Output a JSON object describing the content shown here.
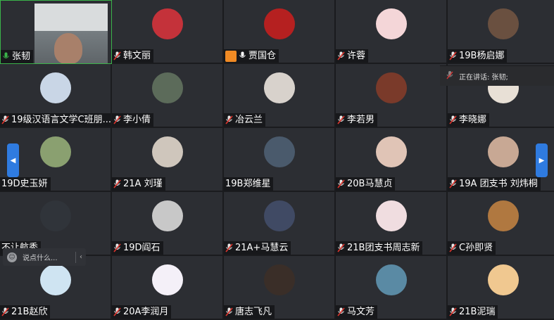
{
  "colors": {
    "speaking_border": "#3bb34a",
    "arrow_blue": "#2f7be0",
    "badge_orange": "#f08a24"
  },
  "participants": [
    {
      "name": "张韧",
      "mic": "active-mic-icon",
      "video": true,
      "avatar_bg": "#8a9296",
      "speaking": true
    },
    {
      "name": "韩文丽",
      "mic": "muted-mic-icon",
      "avatar_bg": "#c4323a"
    },
    {
      "name": "贾国仓",
      "mic": "mic-icon",
      "avatar_bg": "#b52020",
      "badge": "host-badge-icon"
    },
    {
      "name": "许蓉",
      "mic": "muted-mic-icon",
      "avatar_bg": "#f4d6d8"
    },
    {
      "name": "19B杨启娜",
      "mic": "muted-mic-icon",
      "avatar_bg": "#6a5040"
    },
    {
      "name": "19级汉语言文学C班朋...",
      "mic": "muted-mic-icon",
      "avatar_bg": "#c9d6e6"
    },
    {
      "name": "李小倩",
      "mic": "muted-mic-icon",
      "avatar_bg": "#5c6b5a"
    },
    {
      "name": "冶云兰",
      "mic": "muted-mic-icon",
      "avatar_bg": "#d8d2cc"
    },
    {
      "name": "李若男",
      "mic": "muted-mic-icon",
      "avatar_bg": "#7a3a2a"
    },
    {
      "name": "李晓娜",
      "mic": "muted-mic-icon",
      "avatar_bg": "#e8e0d6"
    },
    {
      "name": "19D史玉妍",
      "mic": "",
      "avatar_bg": "#8aa070"
    },
    {
      "name": "21A  刘瑾",
      "mic": "muted-mic-icon",
      "avatar_bg": "#cfc6bc"
    },
    {
      "name": "19B郑维星",
      "mic": "",
      "avatar_bg": "#4a5a6c"
    },
    {
      "name": "20B马慧贞",
      "mic": "muted-mic-icon",
      "avatar_bg": "#e0c4b6"
    },
    {
      "name": "19A 团支书 刘炜桐",
      "mic": "muted-mic-icon",
      "avatar_bg": "#c8a894"
    },
    {
      "name": "不让航秀",
      "mic": "",
      "avatar_bg": "#30343a"
    },
    {
      "name": "19D阎石",
      "mic": "muted-mic-icon",
      "avatar_bg": "#c8c8c8"
    },
    {
      "name": "21A+马慧云",
      "mic": "muted-mic-icon",
      "avatar_bg": "#404a64"
    },
    {
      "name": "21B团支书周志新",
      "mic": "muted-mic-icon",
      "avatar_bg": "#f0dde0"
    },
    {
      "name": "C孙即贤",
      "mic": "muted-mic-icon",
      "avatar_bg": "#b07840"
    },
    {
      "name": "21B赵欣",
      "mic": "muted-mic-icon",
      "avatar_bg": "#cfe4f2"
    },
    {
      "name": "20A李润月",
      "mic": "muted-mic-icon",
      "avatar_bg": "#f4f0f8"
    },
    {
      "name": "唐志飞凡",
      "mic": "muted-mic-icon",
      "avatar_bg": "#3a2e28"
    },
    {
      "name": "马文芳",
      "mic": "muted-mic-icon",
      "avatar_bg": "#5a8aa4"
    },
    {
      "name": "21B泥瑞",
      "mic": "muted-mic-icon",
      "avatar_bg": "#f0c890"
    }
  ],
  "speaker_panel": {
    "label": "正在讲话: 张韧;",
    "icon": "muted-mic-icon"
  },
  "chat": {
    "placeholder": "说点什么...",
    "icon": "smile-icon",
    "collapse": "‹"
  },
  "nav": {
    "left": "◀",
    "right": "▶"
  }
}
